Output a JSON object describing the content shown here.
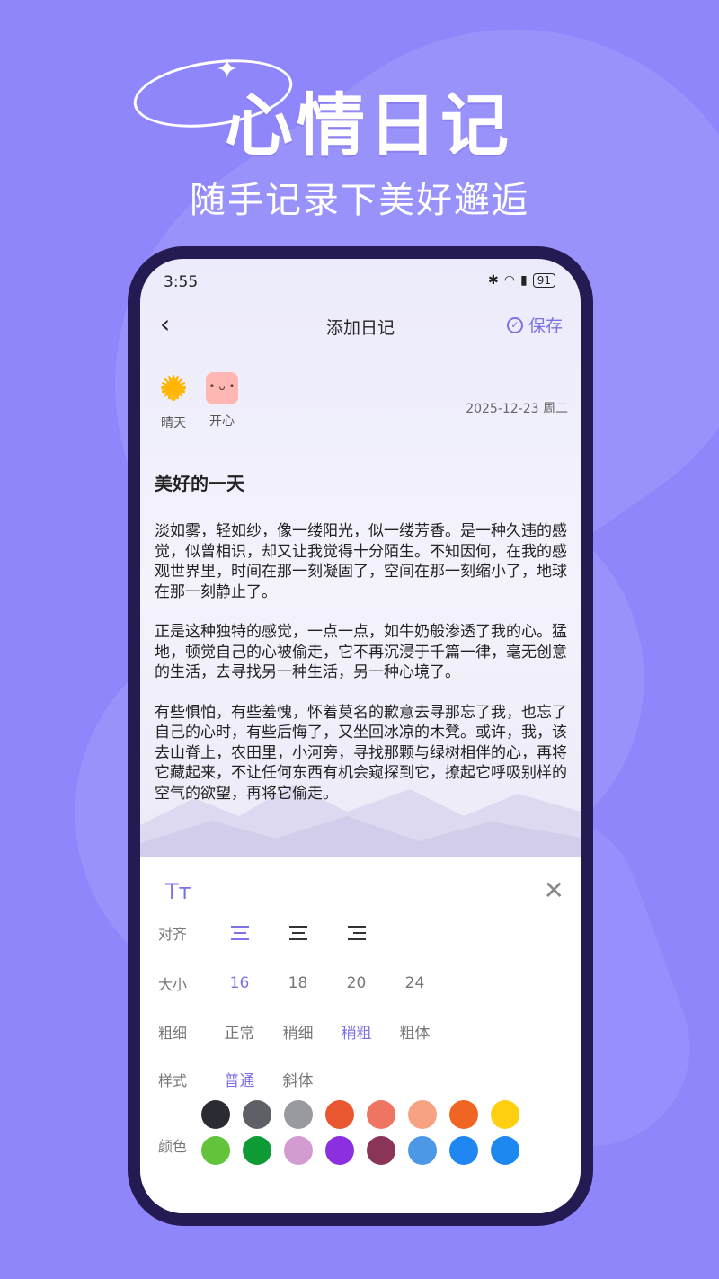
{
  "hero": {
    "title": "心情日记",
    "subtitle": "随手记录下美好邂逅"
  },
  "status_bar": {
    "time": "3:55",
    "battery": "91"
  },
  "navbar": {
    "title": "添加日记",
    "save_label": "保存"
  },
  "tags": {
    "weather_label": "晴天",
    "mood_label": "开心"
  },
  "date": "2025-12-23 周二",
  "entry": {
    "title": "美好的一天",
    "paragraphs": [
      "淡如雾，轻如纱，像一缕阳光，似一缕芳香。是一种久违的感觉，似曾相识，却又让我觉得十分陌生。不知因何，在我的感观世界里，时间在那一刻凝固了，空间在那一刻缩小了，地球在那一刻静止了。",
      "正是这种独特的感觉，一点一点，如牛奶般渗透了我的心。猛地，顿觉自己的心被偷走，它不再沉浸于千篇一律，毫无创意的生活，去寻找另一种生活，另一种心境了。",
      "有些惧怕，有些羞愧，怀着莫名的歉意去寻那忘了我，也忘了自己的心时，有些后悔了，又坐回冰凉的木凳。或许，我，该去山脊上，农田里，小河旁，寻找那颗与绿树相伴的心，再将它藏起来，不让任何东西有机会窥探到它，撩起它呼吸别样的空气的欲望，再将它偷走。"
    ]
  },
  "panel": {
    "tt_icon": "Tт",
    "align_label": "对齐",
    "size_label": "大小",
    "sizes": [
      "16",
      "18",
      "20",
      "24"
    ],
    "weight_label": "粗细",
    "weights": [
      "正常",
      "稍细",
      "稍粗",
      "粗体"
    ],
    "style_label": "样式",
    "styles": [
      "普通",
      "斜体"
    ],
    "color_label": "颜色",
    "selected_size": "16",
    "selected_weight": "稍粗",
    "selected_style": "普通",
    "colors": [
      "#2b2b33",
      "#5f5f66",
      "#999aa0",
      "#e8572f",
      "#ee7562",
      "#f7a283",
      "#f06522",
      "#ffd012",
      "#63c43b",
      "#0e9b35",
      "#d49bd0",
      "#8c2fe0",
      "#8a3558",
      "#4c98e6",
      "#1f86f2",
      "#1c88f0"
    ]
  },
  "accent_color": "#7b72e6"
}
